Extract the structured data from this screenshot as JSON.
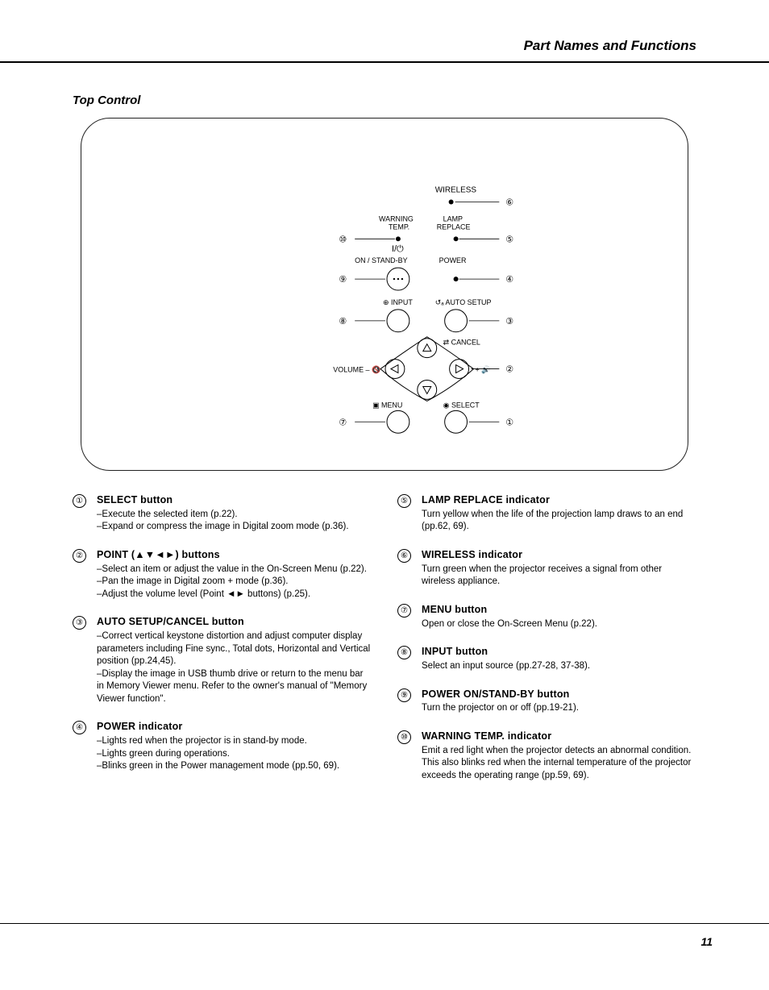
{
  "header": {
    "category": "Part Names and Functions"
  },
  "section_title": "Top Control",
  "diagram": {
    "labels": {
      "wireless": "WIRELESS",
      "warning_temp": "WARNING\nTEMP.",
      "lamp_replace": "LAMP\nREPLACE",
      "on_standby": "ON / STAND-BY",
      "power": "POWER",
      "power_sym": "I/⏻",
      "input": "INPUT",
      "auto_setup": "AUTO SETUP",
      "cancel": "CANCEL",
      "volume_minus": "VOLUME –",
      "volume_plus": "+",
      "menu": "MENU",
      "select": "SELECT"
    },
    "callouts": [
      "①",
      "②",
      "③",
      "④",
      "⑤",
      "⑥",
      "⑦",
      "⑧",
      "⑨",
      "⑩"
    ]
  },
  "items_left": [
    {
      "num": "①",
      "title": "SELECT button",
      "desc": "–Execute the selected item (p.22).\n–Expand or compress the image in Digital zoom mode (p.36)."
    },
    {
      "num": "②",
      "title": "POINT (▲▼◄►) buttons",
      "desc": "–Select an item or adjust the value in the On-Screen Menu (p.22).\n–Pan the image in Digital zoom + mode (p.36).\n–Adjust the volume level (Point ◄► buttons) (p.25)."
    },
    {
      "num": "③",
      "title": "AUTO SETUP/CANCEL button",
      "desc": "–Correct vertical keystone distortion and adjust computer display parameters including Fine sync., Total dots, Horizontal and Vertical position (pp.24,45).\n–Display the image in USB thumb drive or return to the menu bar in Memory Viewer menu. Refer to the owner's manual of \"Memory Viewer function\"."
    },
    {
      "num": "④",
      "title": "POWER indicator",
      "desc": "–Lights red when the projector is in stand-by mode.\n–Lights green during operations.\n–Blinks green in the Power management mode (pp.50, 69)."
    }
  ],
  "items_right": [
    {
      "num": "⑤",
      "title": "LAMP REPLACE indicator",
      "desc": "Turn yellow when the life of the projection lamp draws to an end (pp.62, 69)."
    },
    {
      "num": "⑥",
      "title": "WIRELESS indicator",
      "desc": "Turn green when the projector receives a signal from other wireless appliance."
    },
    {
      "num": "⑦",
      "title": "MENU button",
      "desc": "Open or close the On-Screen Menu (p.22)."
    },
    {
      "num": "⑧",
      "title": "INPUT button",
      "desc": "Select an input source (pp.27-28, 37-38)."
    },
    {
      "num": "⑨",
      "title": "POWER ON/STAND-BY button",
      "desc": "Turn the projector on or off (pp.19-21)."
    },
    {
      "num": "⑩",
      "title": "WARNING TEMP. indicator",
      "desc": "Emit a red light when the projector detects an abnormal condition. This also blinks red when the internal temperature of the projector exceeds the operating range (pp.59, 69)."
    }
  ],
  "page_number": "11"
}
